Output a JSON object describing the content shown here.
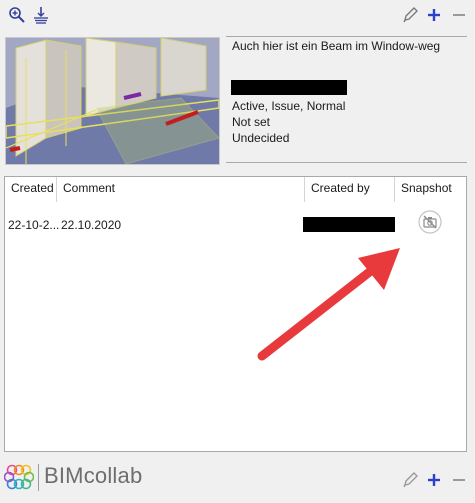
{
  "toolbar_top": {
    "icons": [
      "zoom-in-icon",
      "filter-icon",
      "edit-icon",
      "add-icon",
      "remove-icon"
    ]
  },
  "issue": {
    "title": "Auch hier ist ein Beam im Window-weg",
    "status_line": "Active, Issue, Normal",
    "milestone": "Not set",
    "decision": "Undecided"
  },
  "comments_table": {
    "headers": {
      "created": "Created",
      "comment": "Comment",
      "created_by": "Created by",
      "snapshot": "Snapshot"
    },
    "rows": [
      {
        "created": "22-10-2...",
        "comment": "22.10.2020",
        "snapshot_icon": "no-camera-icon"
      }
    ]
  },
  "footer": {
    "brand": "BIMcollab",
    "icons": [
      "edit-icon",
      "add-icon",
      "remove-icon"
    ]
  },
  "colors": {
    "accent_blue": "#2b3fd1",
    "icon_gray": "#7a7a7a",
    "annotation_red": "#e8393c"
  }
}
